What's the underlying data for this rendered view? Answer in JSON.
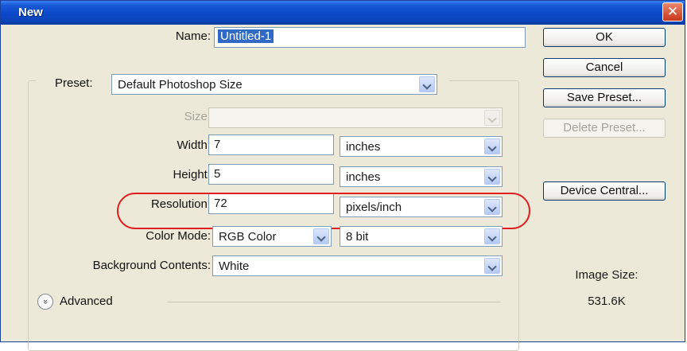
{
  "window": {
    "title": "New",
    "close_glyph": "✕"
  },
  "form": {
    "name_label": "Name:",
    "name_value": "Untitled-1",
    "preset_label": "Preset:",
    "preset_value": "Default Photoshop Size",
    "size_label": "Size:",
    "size_value": "",
    "width_label": "Width:",
    "width_value": "7",
    "width_unit": "inches",
    "height_label": "Height:",
    "height_value": "5",
    "height_unit": "inches",
    "resolution_label": "Resolution:",
    "resolution_value": "72",
    "resolution_unit": "pixels/inch",
    "color_mode_label": "Color Mode:",
    "color_mode_value": "RGB Color",
    "bit_depth_value": "8 bit",
    "background_label": "Background Contents:",
    "background_value": "White",
    "advanced_label": "Advanced",
    "advanced_glyph": "»"
  },
  "buttons": {
    "ok": "OK",
    "cancel": "Cancel",
    "save_preset": "Save Preset...",
    "delete_preset": "Delete Preset...",
    "device_central": "Device Central..."
  },
  "info": {
    "image_size_label": "Image Size:",
    "image_size_value": "531.6K"
  },
  "colors": {
    "titlebar": "#0a48c9",
    "dialog_bg": "#ece9d8",
    "highlight": "#e02020",
    "selection": "#316ac5"
  }
}
